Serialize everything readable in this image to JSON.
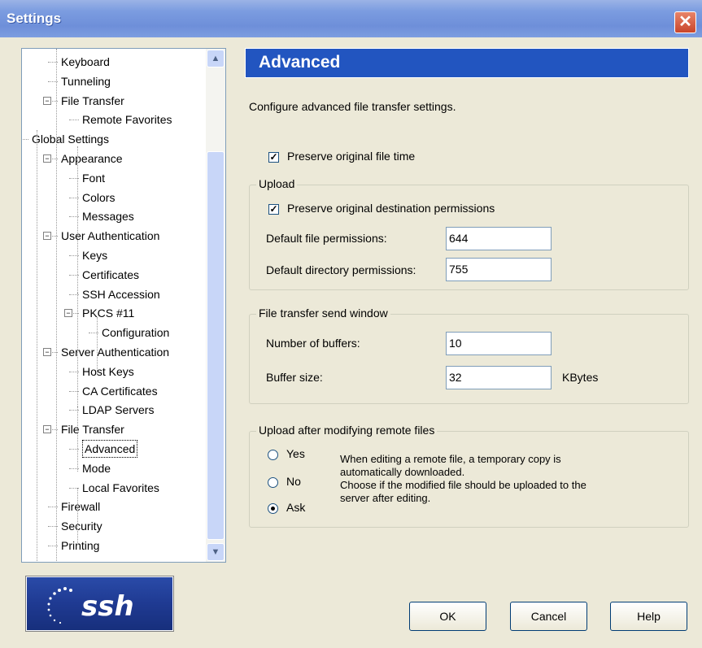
{
  "window": {
    "title": "Settings",
    "close_icon": "close-icon"
  },
  "tree": [
    {
      "label": "Keyboard",
      "level": 2
    },
    {
      "label": "Tunneling",
      "level": 2
    },
    {
      "label": "File Transfer",
      "level": 2,
      "expander": "minus"
    },
    {
      "label": "Remote Favorites",
      "level": 3
    },
    {
      "label": "Global Settings",
      "level": 0,
      "expander": "minus"
    },
    {
      "label": "Appearance",
      "level": 2,
      "expander": "minus"
    },
    {
      "label": "Font",
      "level": 3
    },
    {
      "label": "Colors",
      "level": 3
    },
    {
      "label": "Messages",
      "level": 3
    },
    {
      "label": "User Authentication",
      "level": 2,
      "expander": "minus"
    },
    {
      "label": "Keys",
      "level": 3
    },
    {
      "label": "Certificates",
      "level": 3
    },
    {
      "label": "SSH Accession",
      "level": 3
    },
    {
      "label": "PKCS #11",
      "level": 3,
      "expander": "minus"
    },
    {
      "label": "Configuration",
      "level": 4
    },
    {
      "label": "Server Authentication",
      "level": 2,
      "expander": "minus"
    },
    {
      "label": "Host Keys",
      "level": 3
    },
    {
      "label": "CA Certificates",
      "level": 3
    },
    {
      "label": "LDAP Servers",
      "level": 3
    },
    {
      "label": "File Transfer",
      "level": 2,
      "expander": "minus"
    },
    {
      "label": "Advanced",
      "level": 3,
      "selected": true
    },
    {
      "label": "Mode",
      "level": 3
    },
    {
      "label": "Local Favorites",
      "level": 3
    },
    {
      "label": "Firewall",
      "level": 2
    },
    {
      "label": "Security",
      "level": 2
    },
    {
      "label": "Printing",
      "level": 2
    }
  ],
  "logo": {
    "text": "ssh"
  },
  "panel": {
    "heading": "Advanced",
    "description": "Configure advanced file transfer settings.",
    "preserve_time_label": "Preserve original file time",
    "preserve_time_checked": true,
    "upload": {
      "title": "Upload",
      "preserve_perm_label": "Preserve original destination permissions",
      "preserve_perm_checked": true,
      "file_perm_label": "Default file permissions:",
      "file_perm_value": "644",
      "dir_perm_label": "Default directory permissions:",
      "dir_perm_value": "755"
    },
    "send_window": {
      "title": "File transfer send window",
      "buffers_label": "Number of buffers:",
      "buffers_value": "10",
      "size_label": "Buffer size:",
      "size_value": "32",
      "size_unit": "KBytes"
    },
    "after_modify": {
      "title": "Upload after modifying remote files",
      "options": [
        "Yes",
        "No",
        "Ask"
      ],
      "selected": "Ask",
      "help_line1": "When editing a remote file, a temporary copy is",
      "help_line2": "automatically downloaded.",
      "help_line3": "Choose if the modified file should be uploaded to the",
      "help_line4": "server after editing."
    }
  },
  "buttons": {
    "ok": "OK",
    "cancel": "Cancel",
    "help": "Help"
  }
}
